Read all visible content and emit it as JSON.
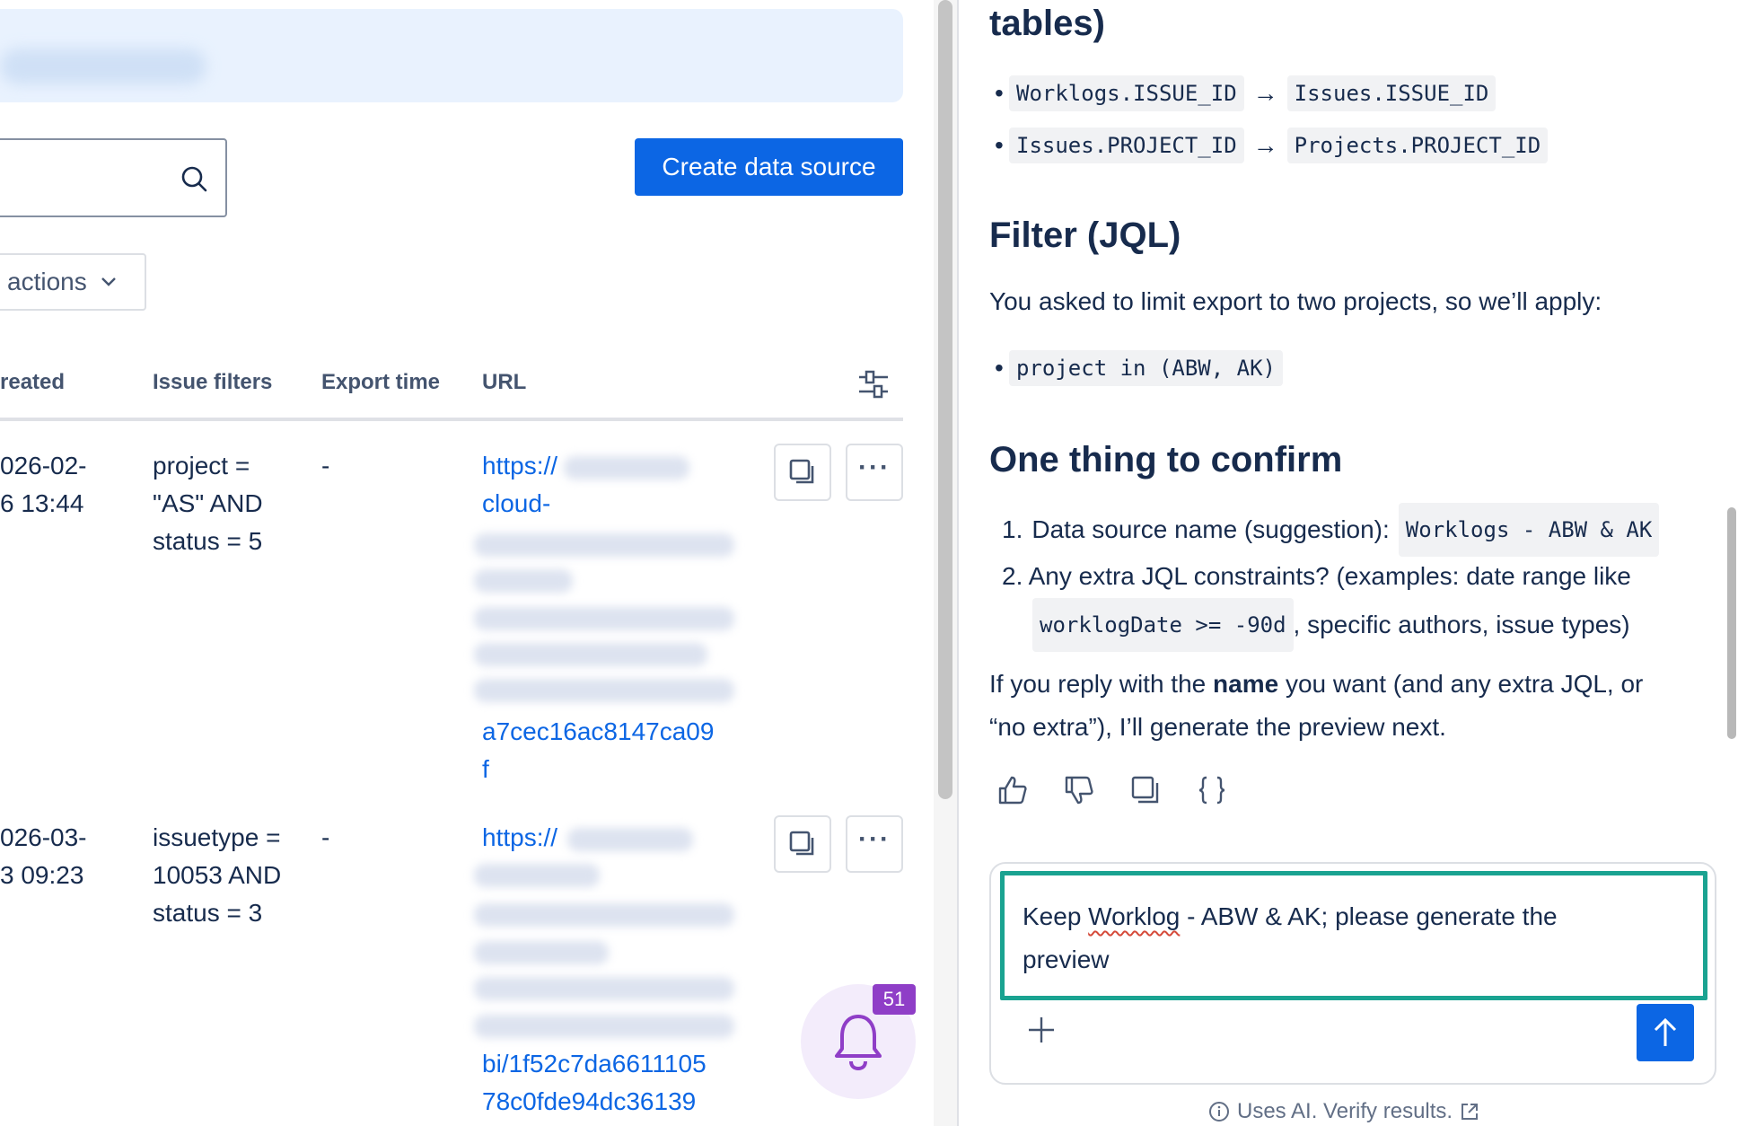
{
  "toolbar": {
    "create_label": "Create data source",
    "actions_label": "actions"
  },
  "table": {
    "headers": [
      "reated",
      "Issue filters",
      "Export time",
      "URL"
    ],
    "rows": [
      {
        "created_line1": "026-02-",
        "created_line2": "6 13:44",
        "filter_line1": "project =",
        "filter_line2": "\"AS\" AND",
        "filter_line3": "status = 5",
        "export_time": "-",
        "url_line1": "https://",
        "url_line2": "cloud-",
        "url_end1": "a7cec16ac8147ca09",
        "url_end2": "f"
      },
      {
        "created_line1": "026-03-",
        "created_line2": "3 09:23",
        "filter_line1": "issuetype =",
        "filter_line2": "10053 AND",
        "filter_line3": "status = 3",
        "export_time": "-",
        "url_line1": "https://",
        "url_end1": "bi/1f52c7da6611105",
        "url_end2": "78c0fde94dc36139"
      }
    ]
  },
  "notifications": {
    "count": "51"
  },
  "chat": {
    "heading_tables": "tables)",
    "joins": [
      {
        "from": "Worklogs.ISSUE_ID",
        "arrow": "→",
        "to": "Issues.ISSUE_ID"
      },
      {
        "from": "Issues.PROJECT_ID",
        "arrow": "→",
        "to": "Projects.PROJECT_ID"
      }
    ],
    "filter_heading": "Filter (JQL)",
    "filter_intro": "You asked to limit export to two projects, so we’ll apply:",
    "filter_code": "project in (ABW, AK)",
    "confirm_heading": "One thing to confirm",
    "confirm_items": [
      {
        "num": "1.",
        "text": "Data source name (suggestion):",
        "code": "Worklogs - ABW & AK"
      },
      {
        "num": "2.",
        "text": "Any extra JQL constraints? (examples: date range like",
        "code": "worklogDate >= -90d",
        "tail": ", specific authors, issue types)"
      }
    ],
    "reply_pre": "If you reply with the ",
    "reply_bold": "name",
    "reply_post": " you want (and any extra JQL, or",
    "reply_line2": "“no extra”), I’ll generate the preview next.",
    "composer_pre": "Keep ",
    "composer_misspelled": "Worklog",
    "composer_post": " - ABW & AK; please generate the",
    "composer_line2": "preview",
    "disclaimer": "Uses AI. Verify results."
  },
  "colors": {
    "primary": "#0c66e4",
    "focus_ring": "#1aa391",
    "badge": "#8f3ec7",
    "banner": "#e9f2fe"
  }
}
